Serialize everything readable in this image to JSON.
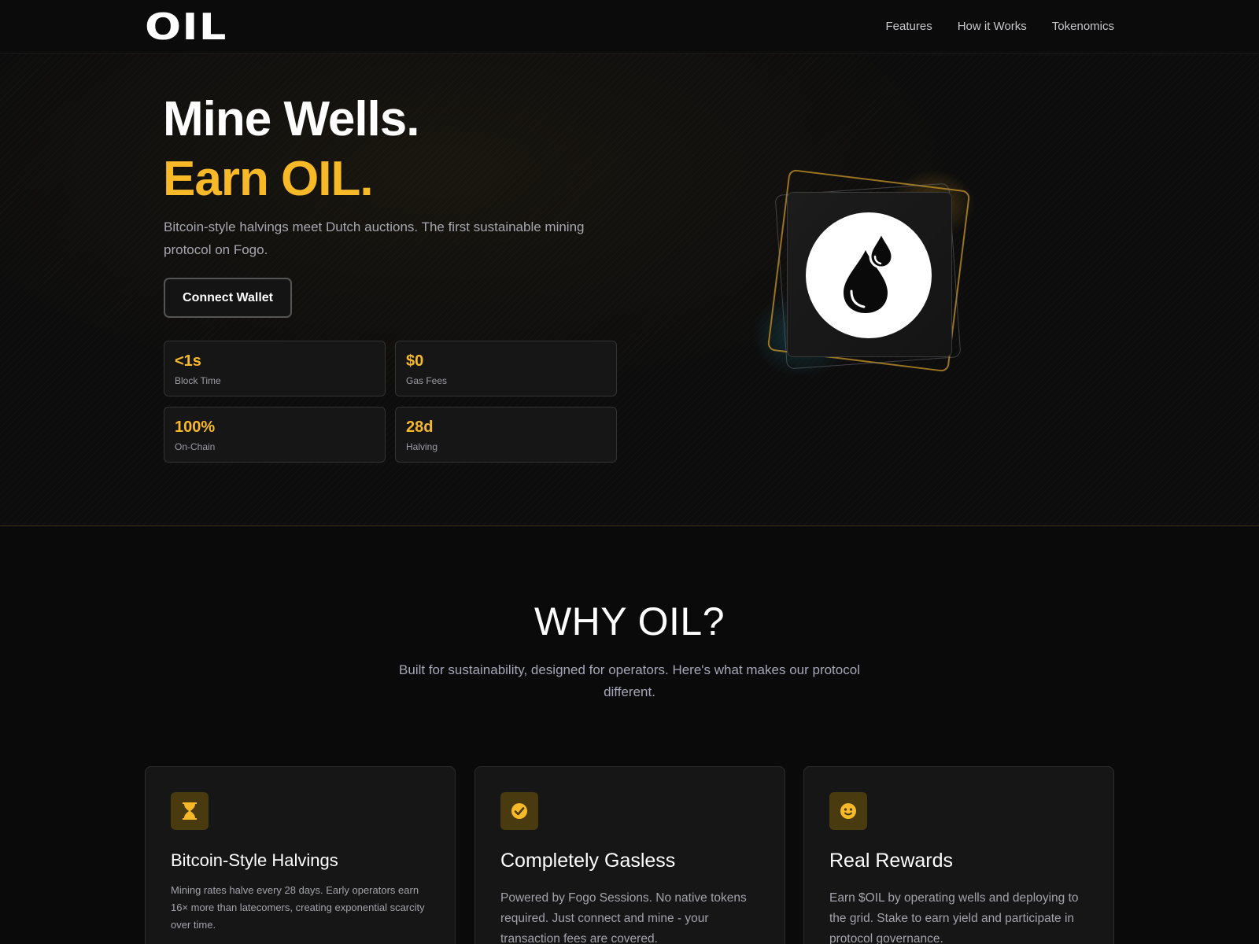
{
  "header": {
    "logo": "OIL",
    "nav": [
      "Features",
      "How it Works",
      "Tokenomics"
    ]
  },
  "hero": {
    "title_line1": "Mine Wells.",
    "title_line2": "Earn OIL.",
    "subtitle": "Bitcoin-style halvings meet Dutch auctions. The first sustainable mining protocol on Fogo.",
    "cta": "Connect Wallet",
    "stats": [
      {
        "value": "<1s",
        "label": "Block Time"
      },
      {
        "value": "$0",
        "label": "Gas Fees"
      },
      {
        "value": "100%",
        "label": "On-Chain"
      },
      {
        "value": "28d",
        "label": "Halving"
      }
    ],
    "visual_icon": "oil-drop-icon"
  },
  "why": {
    "title": "WHY OIL?",
    "subtitle": "Built for sustainability, designed for operators. Here's what makes our protocol different.",
    "cards": [
      {
        "icon": "hourglass-icon",
        "title": "Bitcoin-Style Halvings",
        "desc": "Mining rates halve every 28 days. Early operators earn 16× more than latecomers, creating exponential scarcity over time."
      },
      {
        "icon": "check-circle-icon",
        "title": "Completely Gasless",
        "desc": "Powered by Fogo Sessions. No native tokens required. Just connect and mine - your transaction fees are covered."
      },
      {
        "icon": "smiley-icon",
        "title": "Real Rewards",
        "desc": "Earn $OIL by operating wells and deploying to the grid. Stake to earn yield and participate in protocol governance."
      }
    ]
  },
  "colors": {
    "accent": "#f7b927",
    "background": "#0a0a0a",
    "card": "#161616"
  }
}
